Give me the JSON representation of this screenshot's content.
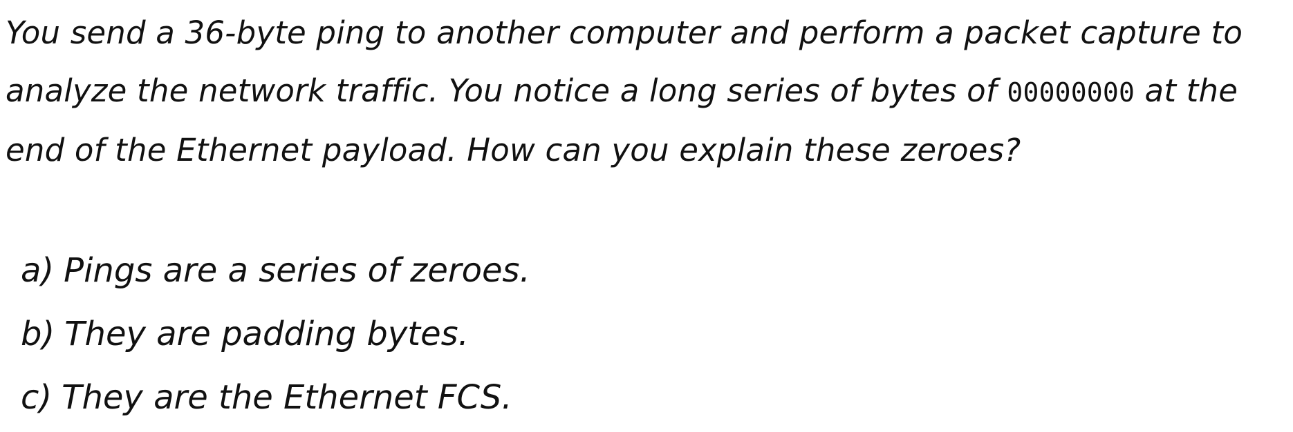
{
  "question": {
    "part1": "You send a 36-byte ping to another computer and perform a packet capture to analyze the network traffic.  You notice a long series of bytes of ",
    "code": "00000000",
    "part2": " at the end of the Ethernet payload.  How can you explain these zeroes?"
  },
  "options": [
    {
      "letter": "a)",
      "text": "Pings are a series of zeroes."
    },
    {
      "letter": "b)",
      "text": "They are padding bytes."
    },
    {
      "letter": "c)",
      "text": "They are the Ethernet FCS."
    }
  ]
}
